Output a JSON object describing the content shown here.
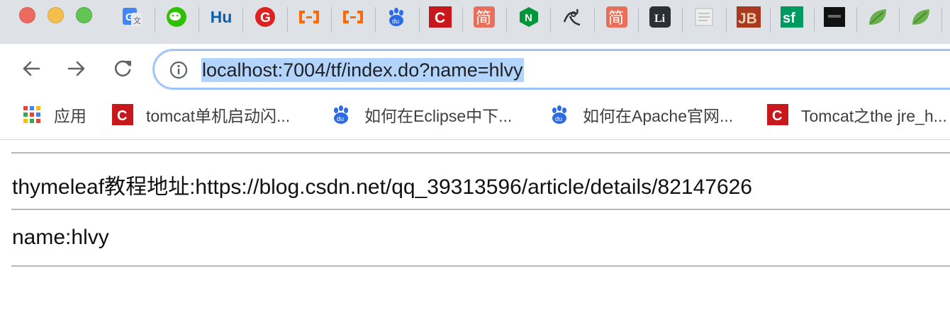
{
  "browser": {
    "url": "localhost:7004/tf/index.do?name=hlvy",
    "extensions": [
      {
        "name": "google-translate-icon"
      },
      {
        "name": "wechat-icon"
      },
      {
        "name": "hu-icon",
        "text": "Hu"
      },
      {
        "name": "g-red-icon",
        "text": "G"
      },
      {
        "name": "aliyun-icon"
      },
      {
        "name": "aliyun-icon-2"
      },
      {
        "name": "baidu-icon"
      },
      {
        "name": "csdn-icon",
        "text": "C"
      },
      {
        "name": "jianshu-icon",
        "text": "简"
      },
      {
        "name": "nginx-icon",
        "text": "N"
      },
      {
        "name": "bird-icon"
      },
      {
        "name": "jianshu-icon-2",
        "text": "简"
      },
      {
        "name": "li-icon",
        "text": "Li"
      },
      {
        "name": "doc-icon"
      },
      {
        "name": "jb-icon",
        "text": "JB"
      },
      {
        "name": "segmentfault-icon",
        "text": "sf"
      },
      {
        "name": "dark-app-icon"
      },
      {
        "name": "leaf-icon"
      },
      {
        "name": "leaf-icon-2"
      }
    ]
  },
  "bookmarks": [
    {
      "label": "应用"
    },
    {
      "label": "tomcat单机启动闪..."
    },
    {
      "label": "如何在Eclipse中下..."
    },
    {
      "label": "如何在Apache官网..."
    },
    {
      "label": "Tomcat之the jre_h..."
    }
  ],
  "page": {
    "line1": "thymeleaf教程地址:https://blog.csdn.net/qq_39313596/article/details/82147626",
    "line2": "name:hlvy"
  },
  "colors": {
    "accent": "#a8c7fa",
    "selection": "#b3d4fc",
    "csdn_red": "#c9171e",
    "jianshu_orange": "#ea6f5a"
  }
}
